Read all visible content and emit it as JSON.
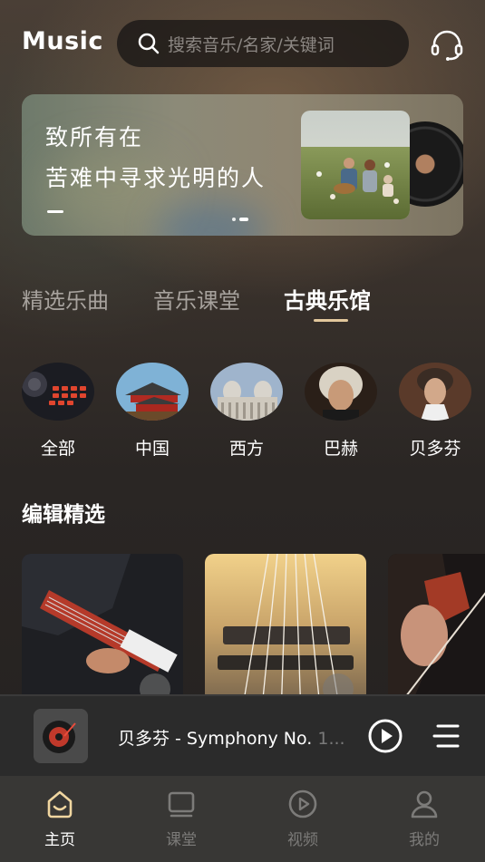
{
  "app": {
    "logo": "Music"
  },
  "search": {
    "placeholder": "搜索音乐/名家/关键词"
  },
  "banner": {
    "line1": "致所有在",
    "line2": "苦难中寻求光明的人"
  },
  "tabs": [
    {
      "label": "精选乐曲",
      "active": false
    },
    {
      "label": "音乐课堂",
      "active": false
    },
    {
      "label": "古典乐馆",
      "active": true
    }
  ],
  "categories": [
    {
      "label": "全部"
    },
    {
      "label": "中国"
    },
    {
      "label": "西方"
    },
    {
      "label": "巴赫"
    },
    {
      "label": "贝多芬"
    }
  ],
  "section": {
    "title": "编辑精选"
  },
  "player": {
    "title_visible": "贝多芬 - Symphony No. ",
    "title_fade": "1..."
  },
  "nav": [
    {
      "label": "主页",
      "icon": "home-icon",
      "active": true
    },
    {
      "label": "课堂",
      "icon": "classroom-icon",
      "active": false
    },
    {
      "label": "视频",
      "icon": "video-icon",
      "active": false
    },
    {
      "label": "我的",
      "icon": "profile-icon",
      "active": false
    }
  ],
  "colors": {
    "accent": "#e2c79c",
    "nav_bg": "#383735",
    "player_bg": "#2b2b2b"
  }
}
